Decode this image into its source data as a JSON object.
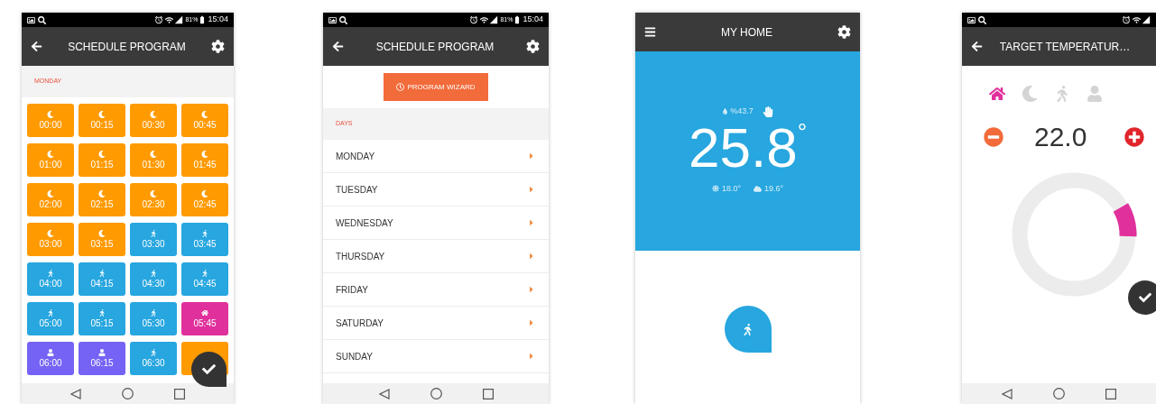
{
  "screens": [
    {
      "kind": "schedule_grid",
      "status_bar": {
        "battery": "81%",
        "time": "15:04"
      },
      "title": "SCHEDULE PROGRAM",
      "section": "MONDAY",
      "slots": [
        {
          "time": "00:00",
          "kind": "night"
        },
        {
          "time": "00:15",
          "kind": "night"
        },
        {
          "time": "00:30",
          "kind": "night"
        },
        {
          "time": "00:45",
          "kind": "night"
        },
        {
          "time": "01:00",
          "kind": "night"
        },
        {
          "time": "01:15",
          "kind": "night"
        },
        {
          "time": "01:30",
          "kind": "night"
        },
        {
          "time": "01:45",
          "kind": "night"
        },
        {
          "time": "02:00",
          "kind": "night"
        },
        {
          "time": "02:15",
          "kind": "night"
        },
        {
          "time": "02:30",
          "kind": "night"
        },
        {
          "time": "02:45",
          "kind": "night"
        },
        {
          "time": "03:00",
          "kind": "night"
        },
        {
          "time": "03:15",
          "kind": "night"
        },
        {
          "time": "03:30",
          "kind": "away"
        },
        {
          "time": "03:45",
          "kind": "away"
        },
        {
          "time": "04:00",
          "kind": "away"
        },
        {
          "time": "04:15",
          "kind": "away"
        },
        {
          "time": "04:30",
          "kind": "away"
        },
        {
          "time": "04:45",
          "kind": "away"
        },
        {
          "time": "05:00",
          "kind": "away"
        },
        {
          "time": "05:15",
          "kind": "away"
        },
        {
          "time": "05:30",
          "kind": "away"
        },
        {
          "time": "05:45",
          "kind": "home"
        },
        {
          "time": "06:00",
          "kind": "person"
        },
        {
          "time": "06:15",
          "kind": "person"
        },
        {
          "time": "06:30",
          "kind": "away"
        },
        {
          "kind": "night"
        }
      ]
    },
    {
      "kind": "day_list",
      "status_bar": {
        "battery": "81%",
        "time": "15:04"
      },
      "title": "SCHEDULE PROGRAM",
      "wizard_button": "PROGRAM WIZARD",
      "section": "DAYS",
      "days": [
        "MONDAY",
        "TUESDAY",
        "WEDNESDAY",
        "THURSDAY",
        "FRIDAY",
        "SATURDAY",
        "SUNDAY"
      ]
    },
    {
      "kind": "home",
      "title": "MY HOME",
      "humidity": "%43.7",
      "temperature": "25.8",
      "degree": "°",
      "outdoor": "18.0°",
      "indoor": "19.6°"
    },
    {
      "kind": "target",
      "title": "TARGET TEMPERATUR…",
      "modes": [
        {
          "kind": "home",
          "selected": true
        },
        {
          "kind": "night",
          "selected": false
        },
        {
          "kind": "away",
          "selected": false
        },
        {
          "kind": "person",
          "selected": false
        }
      ],
      "value": "22.0"
    }
  ]
}
